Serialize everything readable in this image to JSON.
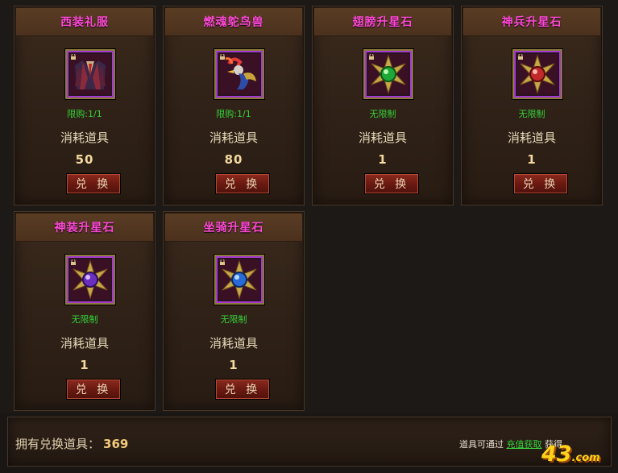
{
  "items": [
    {
      "title": "西装礼服",
      "limit": "限购:1/1",
      "cost_label": "消耗道具",
      "cost": "50",
      "button": "兑 换",
      "icon": "suit-costume-icon",
      "locked": true
    },
    {
      "title": "燃魂鸵鸟兽",
      "limit": "限购:1/1",
      "cost_label": "消耗道具",
      "cost": "80",
      "button": "兑 换",
      "icon": "ostrich-mount-icon",
      "locked": true
    },
    {
      "title": "翅膀升星石",
      "limit": "无限制",
      "cost_label": "消耗道具",
      "cost": "1",
      "button": "兑 换",
      "icon": "green-star-stone-icon",
      "locked": true
    },
    {
      "title": "神兵升星石",
      "limit": "无限制",
      "cost_label": "消耗道具",
      "cost": "1",
      "button": "兑 换",
      "icon": "red-star-stone-icon",
      "locked": true
    },
    {
      "title": "神装升星石",
      "limit": "无限制",
      "cost_label": "消耗道具",
      "cost": "1",
      "button": "兑 换",
      "icon": "purple-star-stone-icon",
      "locked": true
    },
    {
      "title": "坐骑升星石",
      "limit": "无限制",
      "cost_label": "消耗道具",
      "cost": "1",
      "button": "兑 换",
      "icon": "blue-star-stone-icon",
      "locked": true
    }
  ],
  "footer": {
    "owned_label": "拥有兑换道具：",
    "owned_value": "369",
    "hint_prefix": "道具可通过",
    "hint_link": "充值获取",
    "hint_suffix": "获得"
  },
  "watermark": {
    "brand": "43",
    "suffix": ".com"
  },
  "colors": {
    "title": "#ff49d6",
    "limit": "#35d23a",
    "cost": "#f4d9a0",
    "button": "#6a1a12"
  }
}
